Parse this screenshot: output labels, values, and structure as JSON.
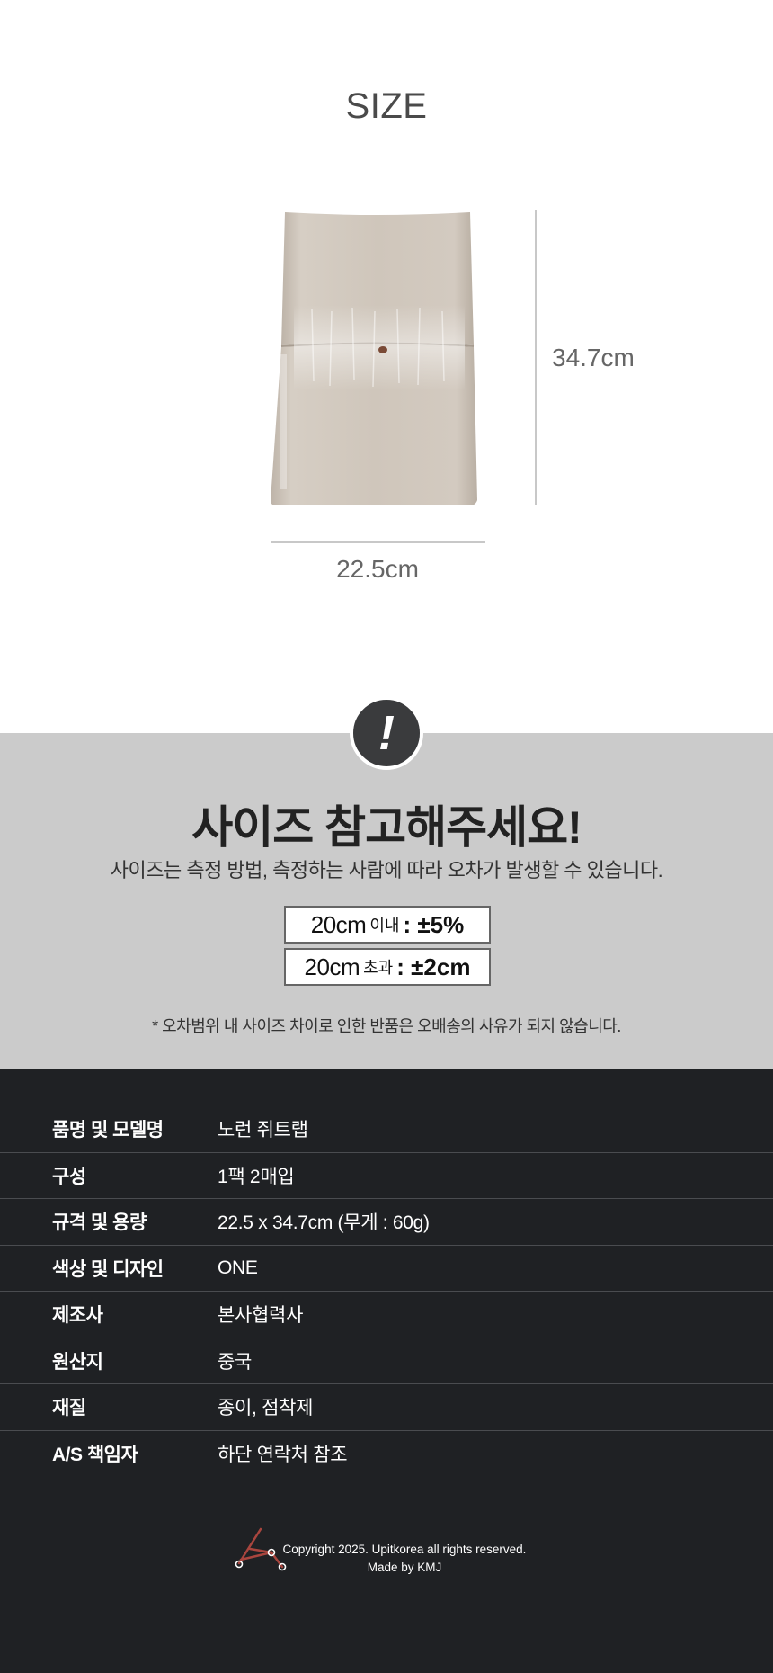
{
  "size": {
    "title": "SIZE",
    "height_label": "34.7cm",
    "width_label": "22.5cm"
  },
  "notice": {
    "icon_glyph": "!",
    "title": "사이즈 참고해주세요!",
    "description": "사이즈는 측정 방법, 측정하는 사람에 따라 오차가 발생할 수 있습니다.",
    "tolerances": [
      {
        "range": "20cm",
        "qualifier": "이내",
        "value": "±5%"
      },
      {
        "range": "20cm",
        "qualifier": "초과",
        "value": "±2cm"
      }
    ],
    "note": "* 오차범위 내 사이즈 차이로 인한 반품은 오배송의 사유가 되지 않습니다."
  },
  "specs": [
    {
      "label": "품명 및 모델명",
      "value": "노런 쥐트랩"
    },
    {
      "label": "구성",
      "value": "1팩 2매입"
    },
    {
      "label": "규격 및 용량",
      "value": "22.5 x 34.7cm (무게 : 60g)"
    },
    {
      "label": "색상 및 디자인",
      "value": "ONE"
    },
    {
      "label": "제조사",
      "value": "본사협력사"
    },
    {
      "label": "원산지",
      "value": "중국"
    },
    {
      "label": "재질",
      "value": "종이, 점착제"
    },
    {
      "label": "A/S 책임자",
      "value": "하단 연락처 참조"
    }
  ],
  "footer": {
    "copyright": "Copyright 2025. Upitkorea all rights reserved.",
    "made_by": "Made by KMJ"
  },
  "colors": {
    "notice_bg": "#cbcbcb",
    "spec_bg": "#1f2124",
    "logo_accent": "#a8453e"
  }
}
